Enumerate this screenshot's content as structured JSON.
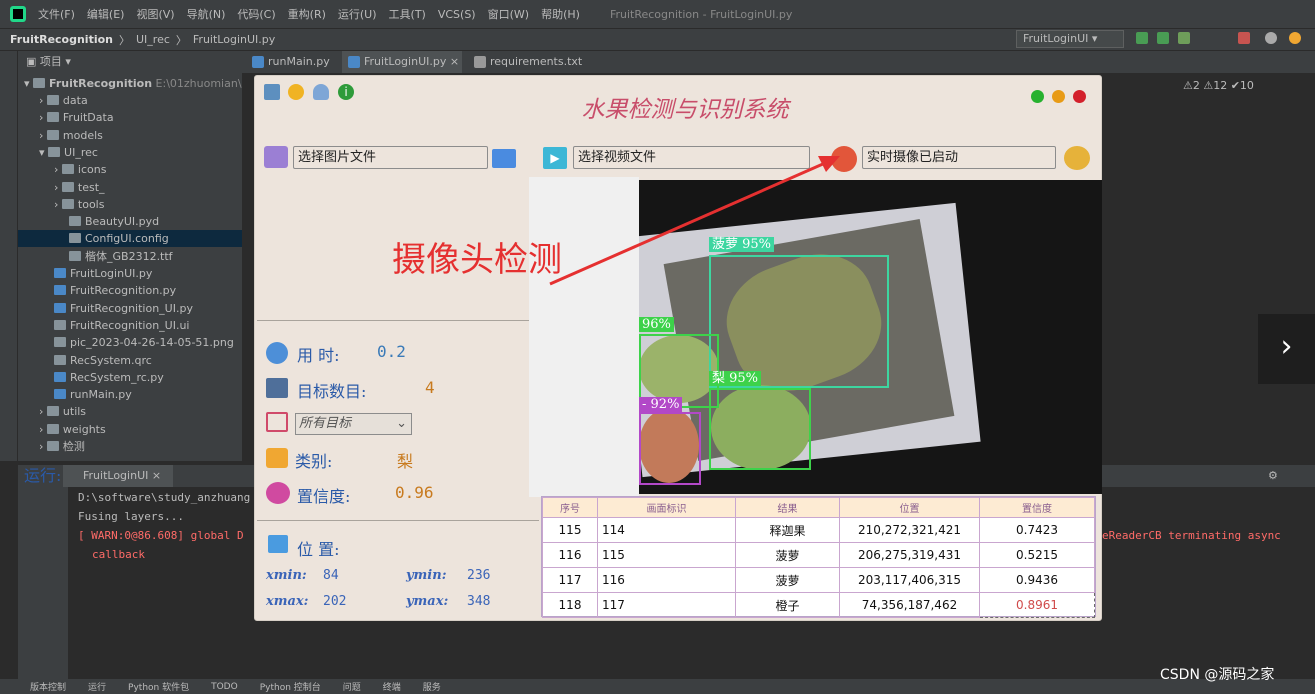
{
  "ide": {
    "menu": [
      "文件(F)",
      "编辑(E)",
      "视图(V)",
      "导航(N)",
      "代码(C)",
      "重构(R)",
      "运行(U)",
      "工具(T)",
      "VCS(S)",
      "窗口(W)",
      "帮助(H)"
    ],
    "window_title": "FruitRecognition - FruitLoginUI.py",
    "breadcrumb": [
      "FruitRecognition",
      "UI_rec",
      "FruitLoginUI.py"
    ],
    "run_config": "FruitLoginUI",
    "editor_tabs": [
      "runMain.py",
      "FruitLoginUI.py",
      "requirements.txt"
    ],
    "inspections": "⚠2  ⚠12  ✔10",
    "project": {
      "header": "项目",
      "root_name": "FruitRecognition",
      "root_path": "E:\\01zhuomian\\Fru",
      "items": [
        {
          "name": "data",
          "type": "folder",
          "depth": 1
        },
        {
          "name": "FruitData",
          "type": "folder",
          "depth": 1
        },
        {
          "name": "models",
          "type": "folder",
          "depth": 1
        },
        {
          "name": "UI_rec",
          "type": "folder",
          "depth": 1
        },
        {
          "name": "icons",
          "type": "folder",
          "depth": 2
        },
        {
          "name": "test_",
          "type": "folder",
          "depth": 2
        },
        {
          "name": "tools",
          "type": "folder",
          "depth": 2
        },
        {
          "name": "BeautyUI.pyd",
          "type": "file",
          "depth": 3
        },
        {
          "name": "ConfigUI.config",
          "type": "file",
          "depth": 3
        },
        {
          "name": "楷体_GB2312.ttf",
          "type": "file",
          "depth": 3
        },
        {
          "name": "FruitLoginUI.py",
          "type": "py",
          "depth": 2
        },
        {
          "name": "FruitRecognition.py",
          "type": "py",
          "depth": 2
        },
        {
          "name": "FruitRecognition_UI.py",
          "type": "py",
          "depth": 2
        },
        {
          "name": "FruitRecognition_UI.ui",
          "type": "file",
          "depth": 2
        },
        {
          "name": "pic_2023-04-26-14-05-51.png",
          "type": "file",
          "depth": 2
        },
        {
          "name": "RecSystem.qrc",
          "type": "file",
          "depth": 2
        },
        {
          "name": "RecSystem_rc.py",
          "type": "py",
          "depth": 2
        },
        {
          "name": "runMain.py",
          "type": "py",
          "depth": 2
        },
        {
          "name": "utils",
          "type": "folder",
          "depth": 1
        },
        {
          "name": "weights",
          "type": "folder",
          "depth": 1
        },
        {
          "name": "检测",
          "type": "folder",
          "depth": 1
        }
      ]
    },
    "run": {
      "label": "运行:",
      "tab": "FruitLoginUI",
      "lines": [
        {
          "text": "D:\\software\\study_anzhuang",
          "warn": false
        },
        {
          "text": "Fusing layers...",
          "warn": false
        },
        {
          "text": "[ WARN:0@86.608] global D",
          "warn": true
        },
        {
          "text": "callback",
          "warn": true
        }
      ],
      "right_text": "eReaderCB terminating async"
    },
    "status": [
      "版本控制",
      "运行",
      "Python 软件包",
      "TODO",
      "Python 控制台",
      "问题",
      "终端",
      "服务"
    ],
    "watermark": "CSDN @源码之家"
  },
  "app": {
    "title": "水果检测与识别系统",
    "select_image": "选择图片文件",
    "select_video": "选择视频文件",
    "camera_status": "实时摄像已启动",
    "annotation": "摄像头检测",
    "time_label": "用  时:",
    "time_value": "0.2",
    "count_label": "目标数目:",
    "count_value": "4",
    "filter_value": "所有目标",
    "class_label": "类别:",
    "class_value": "梨",
    "conf_label": "置信度:",
    "conf_value": "0.96",
    "pos_label": "位  置:",
    "xmin_label": "xmin:",
    "xmin": "84",
    "ymin_label": "ymin:",
    "ymin": "236",
    "xmax_label": "xmax:",
    "xmax": "202",
    "ymax_label": "ymax:",
    "ymax": "348",
    "detections": [
      {
        "label": "菠萝 95%",
        "color": "#3dd6a0"
      },
      {
        "label": "96%",
        "color": "#3dd24a"
      },
      {
        "label": "梨 95%",
        "color": "#3dd24a"
      },
      {
        "label": "- 92%",
        "color": "#b248c8"
      }
    ],
    "table": {
      "headers": [
        "序号",
        "画面标识",
        "结果",
        "位置",
        "置信度"
      ],
      "rows": [
        [
          "115",
          "114",
          "释迦果",
          "210,272,321,421",
          "0.7423"
        ],
        [
          "116",
          "115",
          "菠萝",
          "206,275,319,431",
          "0.5215"
        ],
        [
          "117",
          "116",
          "菠萝",
          "203,117,406,315",
          "0.9436"
        ],
        [
          "118",
          "117",
          "橙子",
          "74,356,187,462",
          "0.8961"
        ]
      ]
    }
  }
}
